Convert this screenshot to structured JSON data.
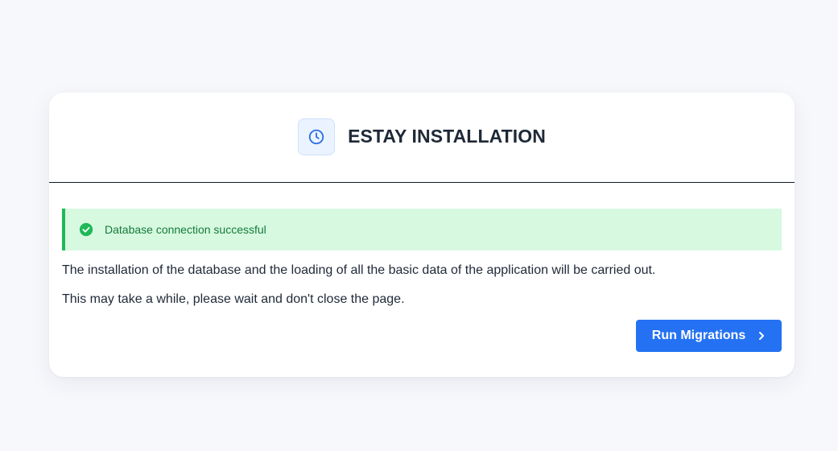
{
  "header": {
    "title": "ESTAY INSTALLATION",
    "icon": "clock-icon"
  },
  "alert": {
    "icon": "check-circle-icon",
    "message": "Database connection successful",
    "color": "#1fb957"
  },
  "body": {
    "paragraph_1": "The installation of the database and the loading of all the basic data of the application will be carried out.",
    "paragraph_2": "This may take a while, please wait and don't close the page."
  },
  "actions": {
    "run_label": "Run Migrations",
    "run_icon": "chevron-right-icon",
    "accent": "#2472f3"
  }
}
